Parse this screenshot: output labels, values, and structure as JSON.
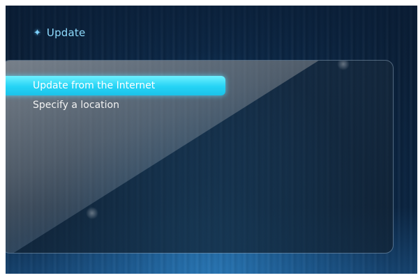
{
  "header": {
    "icon": "diamond-bullet-icon",
    "title": "Update"
  },
  "menu": {
    "items": [
      {
        "label": "Update from the Internet",
        "selected": true
      },
      {
        "label": "Specify a location",
        "selected": false
      }
    ]
  },
  "colors": {
    "accent": "#25d3f5",
    "title": "#8fdcff",
    "background": "#0b2746"
  }
}
